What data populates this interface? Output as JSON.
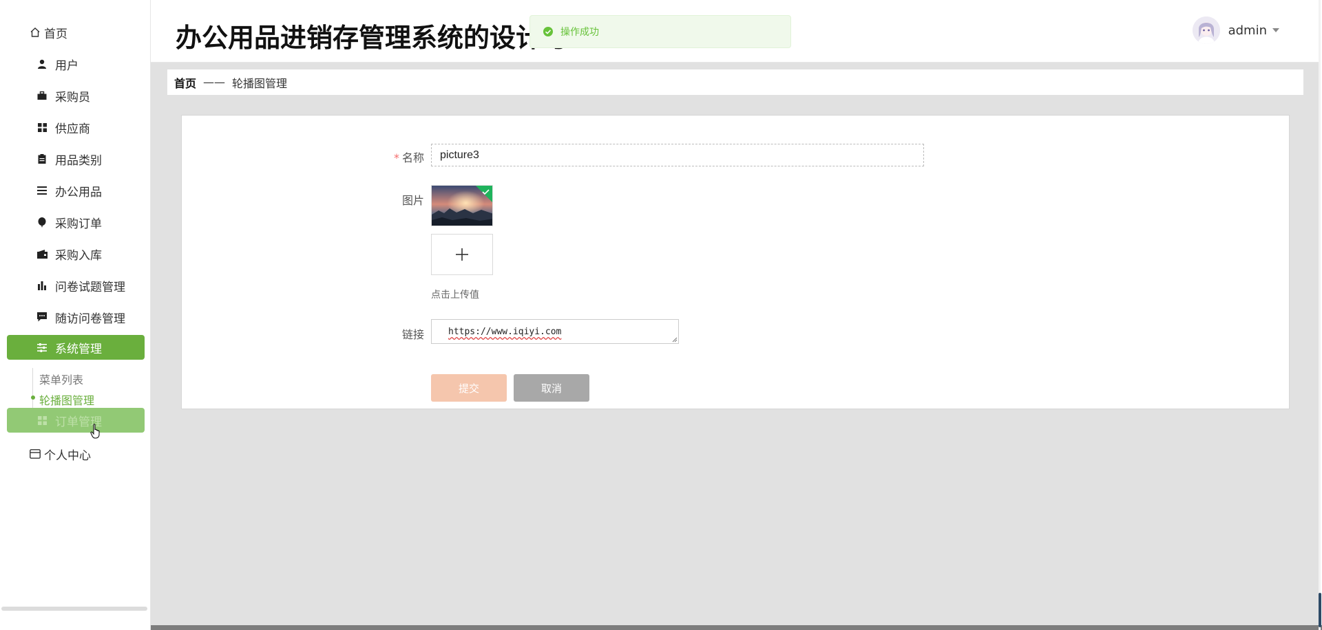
{
  "sidebar": {
    "items": [
      {
        "label": "首页",
        "icon": "home-icon"
      },
      {
        "label": "用户",
        "icon": "user-icon"
      },
      {
        "label": "采购员",
        "icon": "briefcase-icon"
      },
      {
        "label": "供应商",
        "icon": "grid-icon"
      },
      {
        "label": "用品类别",
        "icon": "clipboard-icon"
      },
      {
        "label": "办公用品",
        "icon": "list-icon"
      },
      {
        "label": "采购订单",
        "icon": "balloon-icon"
      },
      {
        "label": "采购入库",
        "icon": "wallet-icon"
      },
      {
        "label": "问卷试题管理",
        "icon": "bar-chart-icon"
      },
      {
        "label": "随访问卷管理",
        "icon": "message-icon"
      },
      {
        "label": "系统管理",
        "icon": "sliders-icon"
      },
      {
        "label": "订单管理",
        "icon": "grid-icon"
      },
      {
        "label": "个人中心",
        "icon": "card-icon"
      }
    ],
    "submenu": [
      {
        "label": "菜单列表"
      },
      {
        "label": "轮播图管理"
      }
    ]
  },
  "header": {
    "title": "办公用品进销存管理系统的设计与",
    "toast": "操作成功",
    "user": "admin"
  },
  "breadcrumb": {
    "home": "首页",
    "separator": "——",
    "current": "轮播图管理"
  },
  "form": {
    "name_label": "名称",
    "name_value": "picture3",
    "image_label": "图片",
    "upload_hint": "点击上传值",
    "link_label": "链接",
    "link_value": "https://www.iqiyi.com",
    "submit_label": "提交",
    "cancel_label": "取消"
  },
  "colors": {
    "accent": "#6aaf3d",
    "submit": "#f5c6ad",
    "cancel": "#a8a8a8",
    "toast_bg": "#f0f9eb"
  }
}
